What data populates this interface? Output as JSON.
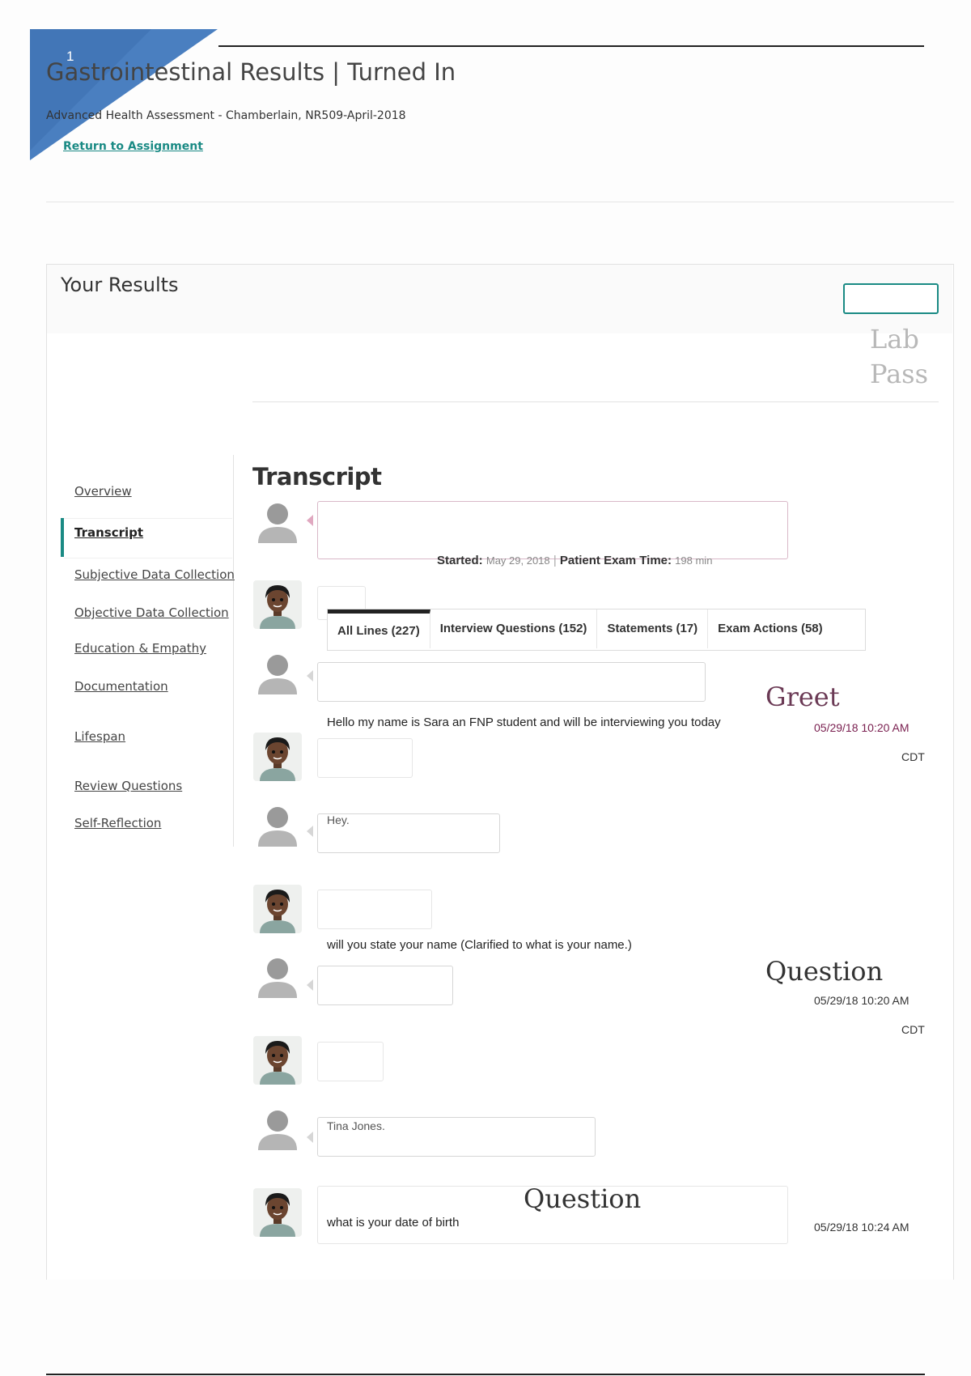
{
  "header": {
    "page_number": "1",
    "title": "Gastrointestinal Results | Turned In",
    "subtitle": "Advanced Health Assessment - Chamberlain, NR509-April-2018",
    "return_link": "Return to Assignment"
  },
  "results": {
    "title": "Your Results",
    "lab_pass_line1": "Lab",
    "lab_pass_line2": "Pass"
  },
  "sidebar": {
    "items": [
      {
        "label": "Overview"
      },
      {
        "label": "Transcript",
        "active": true
      },
      {
        "label": "Subjective Data Collection"
      },
      {
        "label": "Objective Data Collection"
      },
      {
        "label": "Education & Empathy"
      },
      {
        "label": "Documentation"
      },
      {
        "label": "Lifespan"
      },
      {
        "label": "Review Questions"
      },
      {
        "label": "Self-Reflection"
      }
    ]
  },
  "transcript": {
    "title": "Transcript",
    "started_label": "Started:",
    "started_value": "May 29, 2018",
    "exam_time_label": "Patient Exam Time:",
    "exam_time_value": "198 min",
    "tabs": [
      {
        "label": "All Lines (227)",
        "active": true
      },
      {
        "label": "Interview  Questions  (152)"
      },
      {
        "label": "Statements (17)"
      },
      {
        "label": "Exam Actions (58)"
      }
    ],
    "messages": [
      {
        "text": "Hello my name is Sara an FNP student and will be interviewing you today",
        "annotation": "Greet",
        "timestamp": "05/29/18 10:20 AM",
        "tz": "CDT"
      },
      {
        "text": "Hey."
      },
      {
        "text": "will you state your name (Clarified to what is your name.)",
        "annotation": "Question",
        "timestamp": "05/29/18 10:20 AM",
        "tz": "CDT"
      },
      {
        "text": "Tina Jones."
      },
      {
        "text": "what is your date of birth",
        "annotation": "Question",
        "timestamp": "05/29/18 10:24 AM"
      }
    ]
  },
  "colors": {
    "accent": "#1a8a84",
    "annotation": "#6b3a55",
    "timestamp": "#7a2050",
    "corner_blue": "#4a7fc0"
  },
  "icons": {
    "student_avatar": "generic-user-icon",
    "patient_avatar": "patient-avatar-icon"
  }
}
